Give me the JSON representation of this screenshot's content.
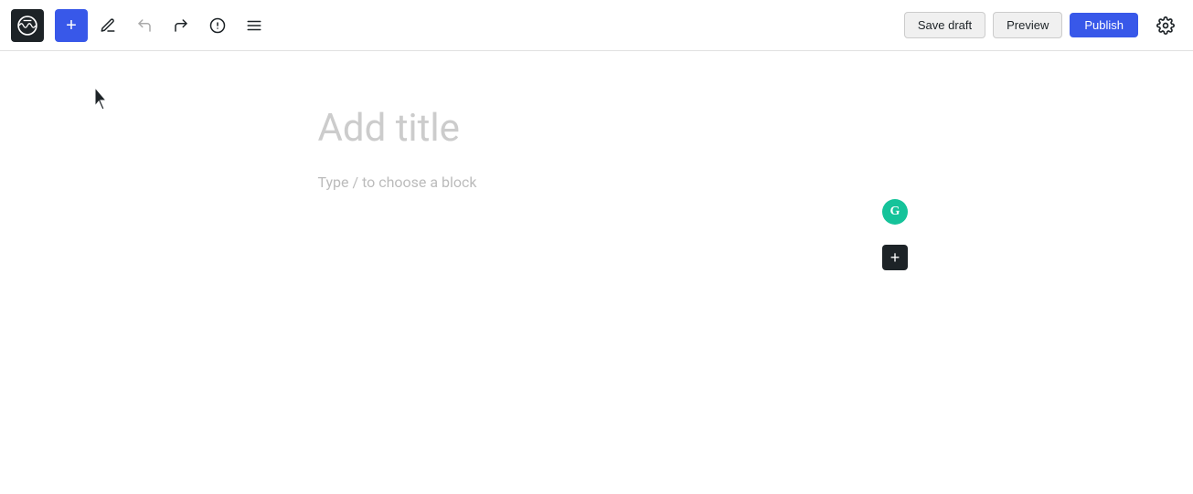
{
  "toolbar": {
    "wp_logo_alt": "WordPress",
    "add_block_label": "+",
    "undo_label": "Undo",
    "redo_label": "Redo",
    "info_label": "Info",
    "list_view_label": "List View",
    "save_draft_label": "Save draft",
    "preview_label": "Preview",
    "publish_label": "Publish",
    "settings_label": "Settings"
  },
  "editor": {
    "title_placeholder": "Add title",
    "block_placeholder": "Type / to choose a block"
  },
  "grammarly": {
    "icon_letter": "G"
  }
}
